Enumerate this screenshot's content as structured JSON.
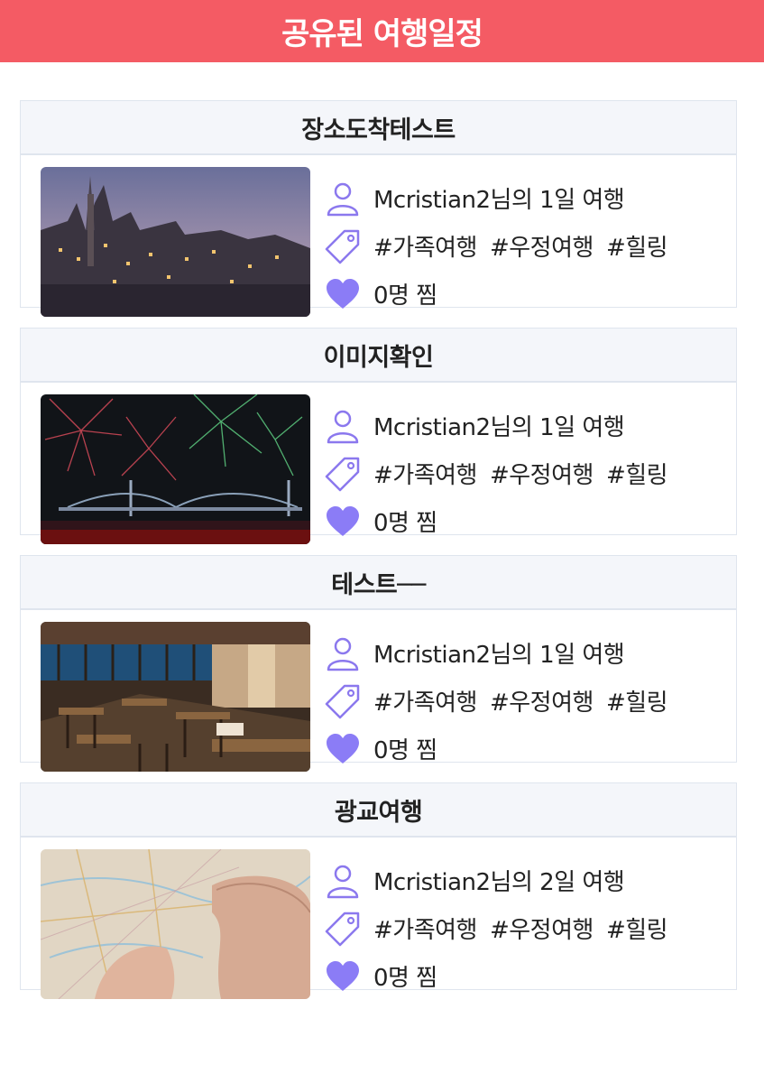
{
  "header": {
    "title": "공유된 여행일정"
  },
  "colors": {
    "header_bg": "#f45b64",
    "icon_accent": "#8b78ee",
    "heart": "#8b7cf6"
  },
  "icons": {
    "author": "person-icon",
    "tags": "tag-icon",
    "likes": "heart-icon"
  },
  "cards": [
    {
      "title": "장소도착테스트",
      "author_line": "Mcristian2님의 1일 여행",
      "tags": [
        "#가족여행",
        "#우정여행",
        "#힐링"
      ],
      "likes_text": "0명 찜",
      "image": "night-town-photo"
    },
    {
      "title": "이미지확인",
      "author_line": "Mcristian2님의 1일 여행",
      "tags": [
        "#가족여행",
        "#우정여행",
        "#힐링"
      ],
      "likes_text": "0명 찜",
      "image": "fireworks-bridge-photo"
    },
    {
      "title": "테스트──",
      "author_line": "Mcristian2님의 1일 여행",
      "tags": [
        "#가족여행",
        "#우정여행",
        "#힐링"
      ],
      "likes_text": "0명 찜",
      "image": "restaurant-interior-photo"
    },
    {
      "title": "광교여행",
      "author_line": "Mcristian2님의 2일 여행",
      "tags": [
        "#가족여행",
        "#우정여행",
        "#힐링"
      ],
      "likes_text": "0명 찜",
      "image": "map-in-hand-photo"
    }
  ]
}
